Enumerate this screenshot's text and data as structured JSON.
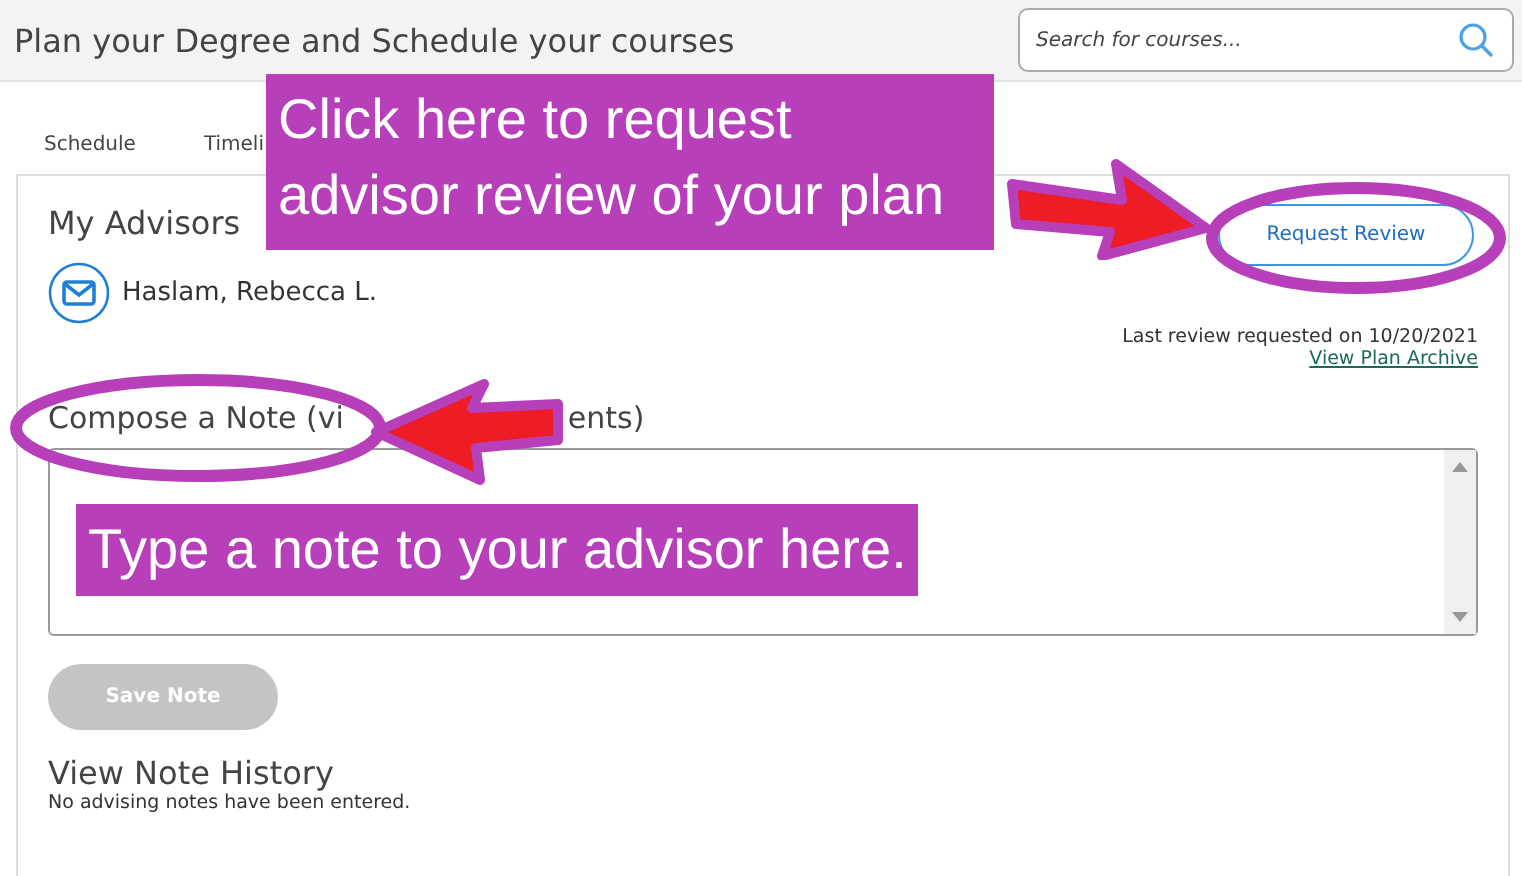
{
  "header": {
    "title": "Plan your Degree and Schedule your courses"
  },
  "search": {
    "placeholder": "Search for courses..."
  },
  "tabs": [
    {
      "label": "Schedule",
      "selected": false
    },
    {
      "label": "Timeli",
      "selected": false
    }
  ],
  "advisors": {
    "heading": "My Advisors",
    "names": [
      "Haslam, Rebecca L."
    ]
  },
  "request_button": "Request Review",
  "last_review": "Last review requested on 10/20/2021",
  "archive_link": "View Plan Archive",
  "compose": {
    "heading_parts": [
      "Compose a Note (vi",
      "ents)"
    ]
  },
  "save_button": {
    "label": "Save Note",
    "disabled": true
  },
  "history": {
    "heading": "View Note History",
    "empty_text": "No advising notes have been entered."
  },
  "annotations": [
    {
      "kind": "callout",
      "text": "Click here to request advisor review of your plan"
    },
    {
      "kind": "callout",
      "text": "Type a note to your advisor here."
    }
  ]
}
